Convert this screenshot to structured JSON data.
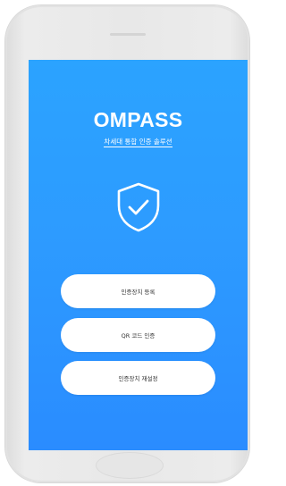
{
  "app": {
    "name": "OMPASS",
    "tagline": "차세대 통합 인증 솔루션"
  },
  "icons": {
    "shield": "shield-check-icon"
  },
  "colors": {
    "screen_top": "#2ba3ff",
    "screen_bottom": "#2a8cff",
    "button_bg": "#ffffff",
    "frame": "#e8e8e8"
  },
  "buttons": [
    {
      "label": "인증장치 등록"
    },
    {
      "label": "QR 코드 인증"
    },
    {
      "label": "인증장치 재설정"
    }
  ]
}
